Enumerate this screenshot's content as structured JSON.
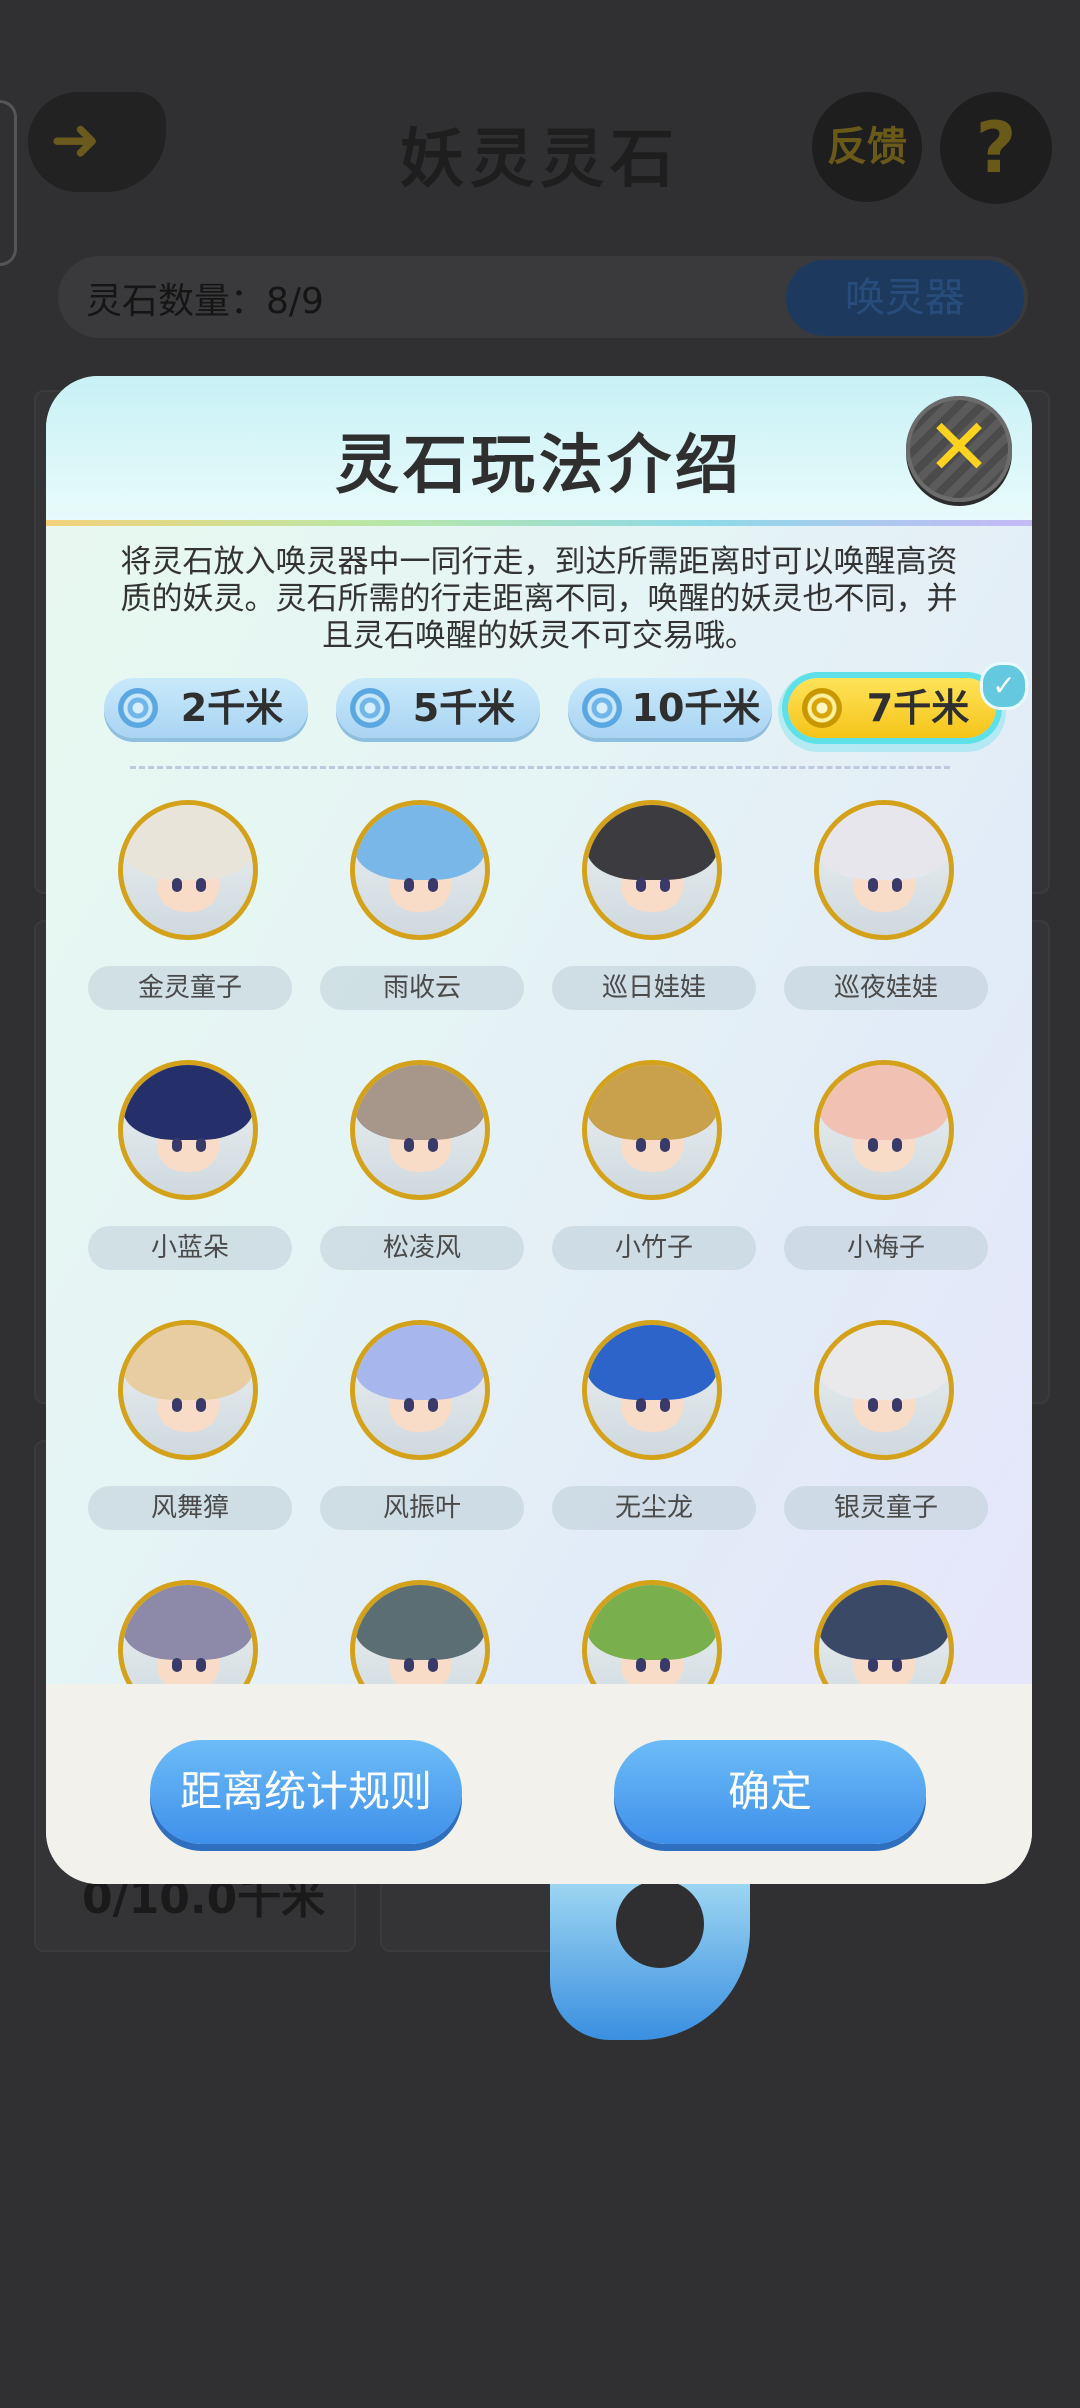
{
  "background": {
    "title": "妖灵灵石",
    "feedback_label": "反馈",
    "help_label": "?",
    "stone_count": "灵石数量：8/9",
    "summon_label": "唤灵器",
    "progress_text": "0/10.0千米"
  },
  "dialog": {
    "title": "灵石玩法介绍",
    "close_label": "✕",
    "description": "将灵石放入唤灵器中一同行走，到达所需距离时可以唤醒高资质的妖灵。灵石所需的行走距离不同，唤醒的妖灵也不同，并且灵石唤醒的妖灵不可交易哦。",
    "tabs": [
      {
        "label": "2千米",
        "active": false
      },
      {
        "label": "5千米",
        "active": false
      },
      {
        "label": "10千米",
        "active": false
      },
      {
        "label": "7千米",
        "active": true
      }
    ],
    "selected_check": "✓",
    "characters": [
      {
        "name": "金灵童子",
        "hair": "#e9e4da"
      },
      {
        "name": "雨收云",
        "hair": "#79b7e8"
      },
      {
        "name": "巡日娃娃",
        "hair": "#3b3b40"
      },
      {
        "name": "巡夜娃娃",
        "hair": "#e6e6ec"
      },
      {
        "name": "小蓝朵",
        "hair": "#25306a"
      },
      {
        "name": "松凌风",
        "hair": "#a7968a"
      },
      {
        "name": "小竹子",
        "hair": "#c9a04c"
      },
      {
        "name": "小梅子",
        "hair": "#f1c2b4"
      },
      {
        "name": "风舞獐",
        "hair": "#e8cda3"
      },
      {
        "name": "风振叶",
        "hair": "#a8b6ee"
      },
      {
        "name": "无尘龙",
        "hair": "#2d64c9"
      },
      {
        "name": "银灵童子",
        "hair": "#e9e9ec"
      },
      {
        "name": "",
        "hair": "#8c8aa8"
      },
      {
        "name": "",
        "hair": "#5a6e74"
      },
      {
        "name": "",
        "hair": "#79b04d"
      },
      {
        "name": "",
        "hair": "#3a4a66"
      }
    ],
    "buttons": {
      "rules_label": "距离统计规则",
      "confirm_label": "确定"
    }
  }
}
